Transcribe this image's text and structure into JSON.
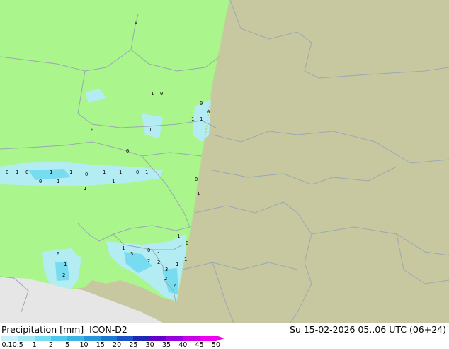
{
  "header": {
    "precip_label": "Precipitation [mm]",
    "model": "ICON-D2",
    "valid_time": "Su 15-02-2026 05..06 UTC (06+24)"
  },
  "legend": {
    "ticks": [
      "0.1",
      "0.5",
      "1",
      "2",
      "5",
      "10",
      "15",
      "20",
      "25",
      "30",
      "35",
      "40",
      "45",
      "50"
    ],
    "colors": [
      "#c8f0f8",
      "#a0e8f4",
      "#78dcf0",
      "#50c8ec",
      "#3cb4e4",
      "#2896dc",
      "#1e78d0",
      "#1e50c8",
      "#1e28b4",
      "#6400c8",
      "#9600dc",
      "#c800e6",
      "#f000f0"
    ]
  },
  "map": {
    "colors": {
      "model_domain": "#aaf58c",
      "outside_domain": "#c8c8a0",
      "sea": "#e6e6e6",
      "borders": "#9aa8b4"
    },
    "values": [
      "0",
      "1",
      "0",
      "0",
      "1",
      "1",
      "0",
      "1",
      "0",
      "0",
      "0",
      "1",
      "0",
      "1",
      "1",
      "0",
      "1",
      "1",
      "0",
      "1",
      "0",
      "1",
      "1",
      "1",
      "0",
      "1",
      "1",
      "0",
      "0",
      "1",
      "2",
      "1",
      "3",
      "0",
      "1",
      "2",
      "2",
      "3",
      "1",
      "1",
      "2",
      "2"
    ]
  }
}
